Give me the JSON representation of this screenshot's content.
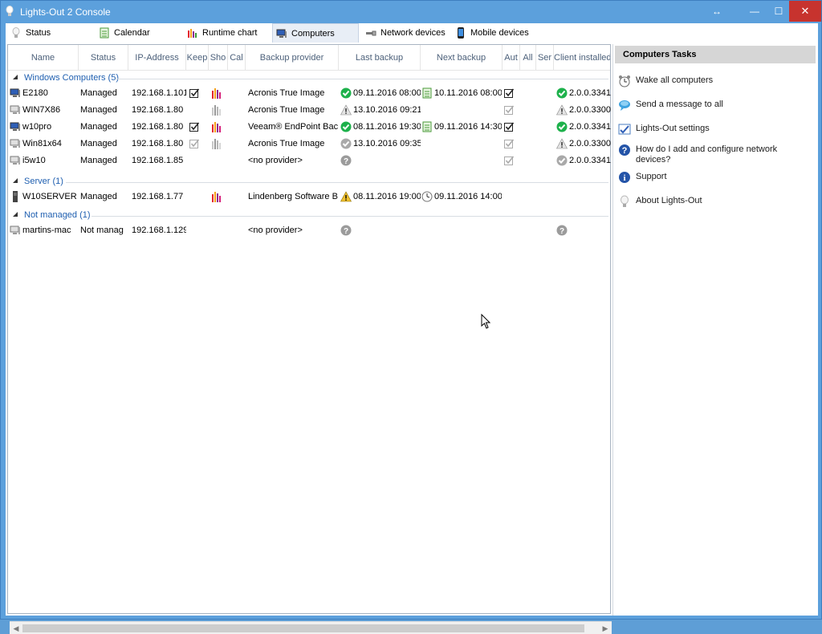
{
  "window": {
    "title": "Lights-Out 2 Console",
    "controls": {
      "resize": "↔",
      "minimize": "—",
      "maximize": "☐",
      "close": "✕"
    }
  },
  "tabs": [
    {
      "label": "Status",
      "icon": "bulb-icon"
    },
    {
      "label": "Calendar",
      "icon": "calendar-icon"
    },
    {
      "label": "Runtime chart",
      "icon": "bar-chart-icon"
    },
    {
      "label": "Computers",
      "icon": "computer-icon",
      "active": true
    },
    {
      "label": "Network devices",
      "icon": "network-cable-icon"
    },
    {
      "label": "Mobile devices",
      "icon": "mobile-phone-icon"
    }
  ],
  "columns": {
    "name": "Name",
    "status": "Status",
    "ip": "IP-Address",
    "keep": "Keep",
    "show": "Sho",
    "cal": "Cal",
    "provider": "Backup provider",
    "last": "Last backup",
    "next": "Next backup",
    "aut": "Aut",
    "all": "All",
    "ser": "Ser",
    "client": "Client installed"
  },
  "groups": [
    {
      "label": "Windows Computers (5)",
      "rows": [
        {
          "name": "E2180",
          "status": "Managed",
          "ip": "192.168.1.101",
          "keep": "check",
          "show": "chart-color",
          "provider": "Acronis True Image",
          "last_icon": "ok",
          "last": "09.11.2016 08:00",
          "next_icon": "calendar",
          "next": "10.11.2016 08:00",
          "aut": "check",
          "client_icon": "ok",
          "client": "2.0.0.3341",
          "pc_icon": "computer-color"
        },
        {
          "name": "WIN7X86",
          "status": "Managed",
          "ip": "192.168.1.80",
          "keep": "",
          "show": "chart-gray",
          "provider": "Acronis True Image",
          "last_icon": "warn-gray",
          "last": "13.10.2016 09:21",
          "next_icon": "",
          "next": "",
          "aut": "check-gray",
          "client_icon": "warn-gray",
          "client": "2.0.0.3300",
          "pc_icon": "computer-gray"
        },
        {
          "name": "w10pro",
          "status": "Managed",
          "ip": "192.168.1.80",
          "keep": "check",
          "show": "chart-color",
          "provider": "Veeam® EndPoint Back",
          "last_icon": "ok",
          "last": "08.11.2016 19:30",
          "next_icon": "calendar",
          "next": "09.11.2016 14:30",
          "aut": "check",
          "client_icon": "ok",
          "client": "2.0.0.3341",
          "pc_icon": "computer-color"
        },
        {
          "name": "Win81x64",
          "status": "Managed",
          "ip": "192.168.1.80",
          "keep": "check-gray",
          "show": "chart-gray",
          "provider": "Acronis True Image",
          "last_icon": "ok-gray",
          "last": "13.10.2016 09:35",
          "next_icon": "",
          "next": "",
          "aut": "check-gray",
          "client_icon": "warn-gray",
          "client": "2.0.0.3300",
          "pc_icon": "computer-gray"
        },
        {
          "name": "i5w10",
          "status": "Managed",
          "ip": "192.168.1.85",
          "keep": "",
          "show": "",
          "provider": "<no provider>",
          "last_icon": "question",
          "last": "",
          "next_icon": "",
          "next": "",
          "aut": "check-gray",
          "client_icon": "ok-gray",
          "client": "2.0.0.3341",
          "pc_icon": "computer-gray"
        }
      ]
    },
    {
      "label": "Server (1)",
      "rows": [
        {
          "name": "W10SERVER",
          "status": "Managed",
          "ip": "192.168.1.77",
          "keep": "",
          "show": "chart-color",
          "provider": "Lindenberg Software Ba",
          "last_icon": "warn",
          "last": "08.11.2016 19:00",
          "next_icon": "clock",
          "next": "09.11.2016 14:00",
          "aut": "",
          "client_icon": "",
          "client": "",
          "pc_icon": "server"
        }
      ]
    },
    {
      "label": "Not managed (1)",
      "rows": [
        {
          "name": "martins-mac",
          "status": "Not manag",
          "ip": "192.168.1.129",
          "keep": "",
          "show": "",
          "provider": "<no provider>",
          "last_icon": "question",
          "last": "",
          "next_icon": "",
          "next": "",
          "aut": "",
          "client_icon": "question",
          "client": "",
          "pc_icon": "computer-gray"
        }
      ]
    }
  ],
  "tasks": {
    "header": "Computers Tasks",
    "items": [
      {
        "label": "Wake all computers",
        "icon": "alarm-clock-icon"
      },
      {
        "label": "Send a message to all",
        "icon": "message-bubble-icon"
      },
      {
        "label": "Lights-Out settings",
        "icon": "settings-checklist-icon"
      },
      {
        "label": "How do I add and configure network devices?",
        "icon": "help-icon"
      },
      {
        "label": "Support",
        "icon": "info-icon"
      },
      {
        "label": "About Lights-Out",
        "icon": "bulb-icon"
      }
    ]
  },
  "colors": {
    "titlebar": "#5ca0dc",
    "group_label": "#1f5fb0",
    "close_button": "#c7332e",
    "ok_green": "#1db14b",
    "warn_yellow": "#f2c230"
  }
}
